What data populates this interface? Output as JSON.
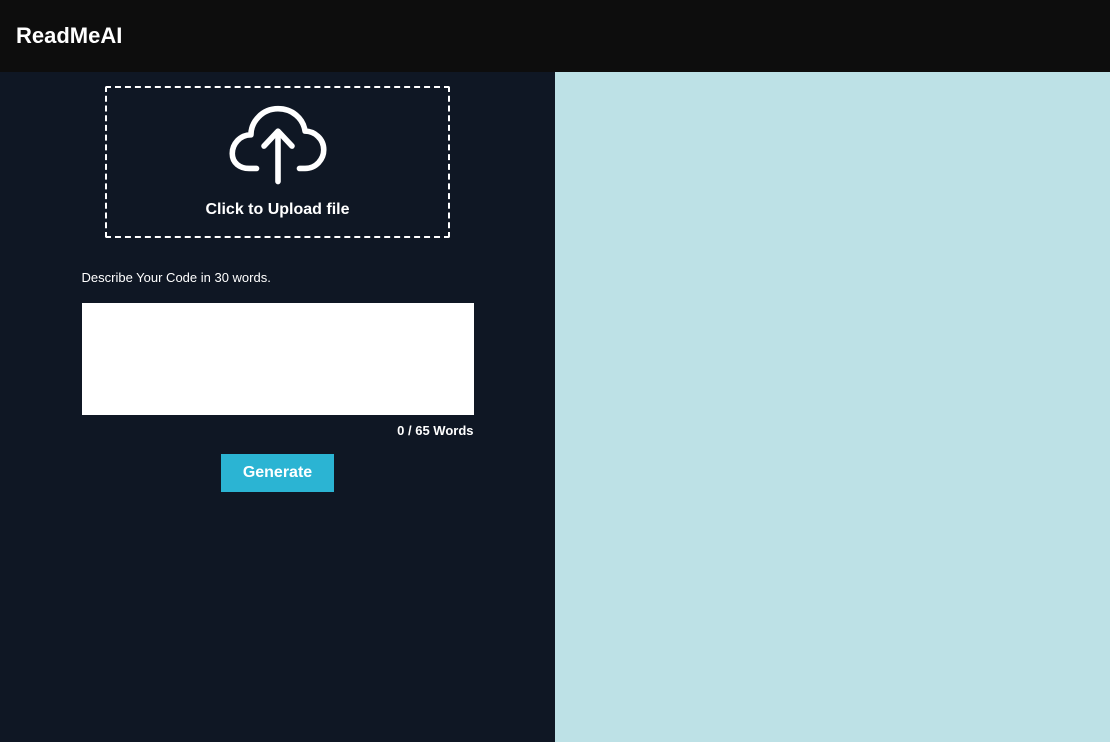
{
  "header": {
    "brand": "ReadMeAI"
  },
  "upload": {
    "label": "Click to Upload file"
  },
  "form": {
    "describe_label": "Describe Your Code in 30 words.",
    "textarea_value": "",
    "word_count": "0 / 65 Words",
    "generate_label": "Generate"
  }
}
